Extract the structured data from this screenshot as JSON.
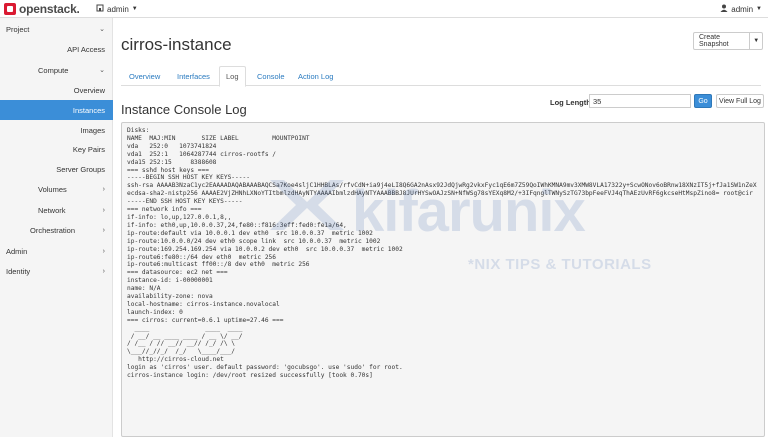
{
  "topbar": {
    "logo_text": "openstack.",
    "project_label": "admin",
    "user_label": "admin"
  },
  "sidebar": {
    "items": [
      {
        "label": "Project",
        "chevron": "v"
      },
      {
        "label": "API Access"
      },
      {
        "label": "Compute",
        "chevron": "v"
      },
      {
        "label": "Overview"
      },
      {
        "label": "Instances",
        "active": true
      },
      {
        "label": "Images"
      },
      {
        "label": "Key Pairs"
      },
      {
        "label": "Server Groups"
      },
      {
        "label": "Volumes",
        "chevron": ">"
      },
      {
        "label": "Network",
        "chevron": ">"
      },
      {
        "label": "Orchestration",
        "chevron": ">"
      },
      {
        "label": "Admin",
        "chevron": ">"
      },
      {
        "label": "Identity",
        "chevron": ">"
      }
    ]
  },
  "main": {
    "title": "cirros-instance",
    "snapshot_button": "Create Snapshot",
    "tabs": [
      {
        "label": "Overview"
      },
      {
        "label": "Interfaces"
      },
      {
        "label": "Log",
        "active": true
      },
      {
        "label": "Console"
      },
      {
        "label": "Action Log"
      }
    ],
    "section_title": "Instance Console Log",
    "log_length_label": "Log Length",
    "log_length_value": "35",
    "go_button": "Go",
    "view_full_button": "View Full Log"
  },
  "console_lines": [
    "Disks:",
    "NAME  MAJ:MIN       SIZE LABEL         MOUNTPOINT",
    "vda   252:0   1073741824",
    "vda1  252:1   1064287744 cirros-rootfs /",
    "vda15 252:15     8388608",
    "=== sshd host keys ===",
    "-----BEGIN SSH HOST KEY KEYS-----",
    "ssh-rsa AAAAB3NzaC1yc2EAAAADAQABAAABAQCSa7Koe4sljC1HHBLAs/rfvCdN+ia9j4eLI8Q6GA2nAsx92JdQjwRg2vkxFyc1qE6m7Z59QoIWhKMNA9mv3XMW8VLA17322y+ScwONov6oBRnw18XNzIT5j+fJa1SW1nZeX",
    "ecdsa-sha2-nistp256 AAAAE2VjZHNhLXNoYTItbmlzdHAyNTYAAAAIbmlzdHAyNTYAAABBBJ8JUrHYSwOAJzSN+NfWSg78sYEXq8M2/+3IFqnglTWNySzTG73bpFeeFVJ4qThAEzUvRF6gkcseHtMspZino8= root@cir",
    "-----END SSH HOST KEY KEYS-----",
    "=== network info ===",
    "if-info: lo,up,127.0.0.1,8,,",
    "if-info: eth0,up,10.0.0.37,24,fe80::f816:3eff:fed0:fe1a/64,",
    "ip-route:default via 10.0.0.1 dev eth0  src 10.0.0.37  metric 1002",
    "ip-route:10.0.0.0/24 dev eth0 scope link  src 10.0.0.37  metric 1002",
    "ip-route:169.254.169.254 via 10.0.0.2 dev eth0  src 10.0.0.37  metric 1002",
    "ip-route6:fe80::/64 dev eth0  metric 256",
    "ip-route6:multicast ff00::/8 dev eth0  metric 256",
    "=== datasource: ec2 net ===",
    "instance-id: i-00000001",
    "name: N/A",
    "availability-zone: nova",
    "local-hostname: cirros-instance.novalocal",
    "launch-index: 0",
    "=== cirros: current=0.6.1 uptime=27.46 ===",
    "  ____               ____  ____",
    " / __/ __ ____ ____ / __ \\/ __/",
    "/ /__ / // __// __// /_/ /\\ \\",
    "\\___//_//_/  /_/   \\____/___/",
    "   http://cirros-cloud.net",
    "",
    "",
    "login as 'cirros' user. default password: 'gocubsgo'. use 'sudo' for root.",
    "cirros-instance login: /dev/root resized successfully [took 0.70s]"
  ],
  "watermark": {
    "brand": "kifarunix",
    "tagline": "*NIX TIPS & TUTORIALS"
  },
  "icons": {
    "logo": "openstack-logo-icon",
    "project_dropdown": "building-icon",
    "user_menu": "user-icon"
  },
  "colors": {
    "accent": "#3b8ed8",
    "link": "#2a7bc0",
    "logo_red": "#da1a32"
  }
}
